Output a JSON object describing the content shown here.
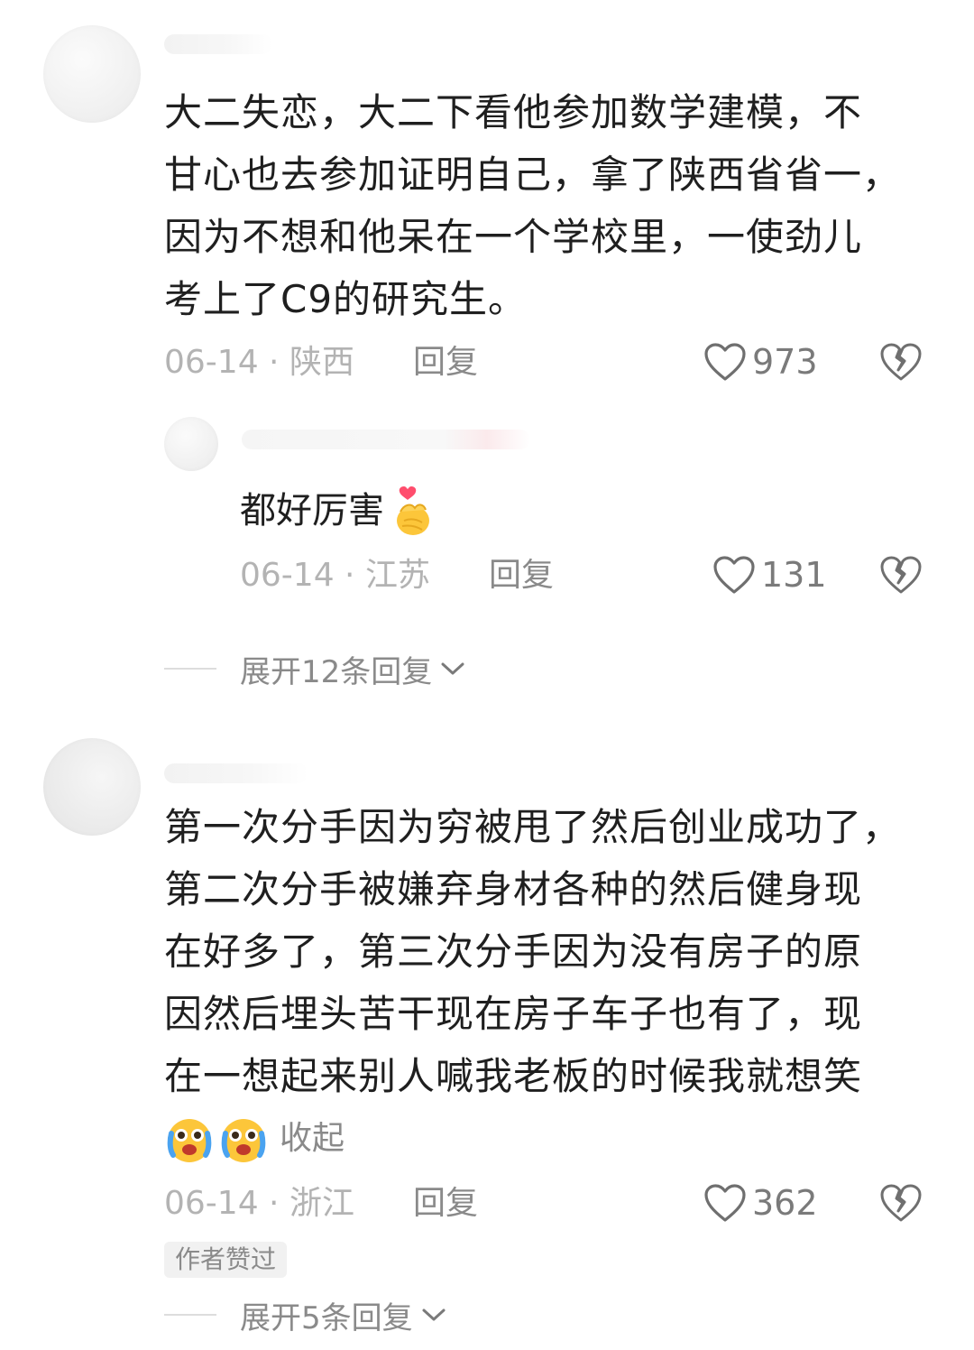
{
  "comments": [
    {
      "text": "大二失恋，大二下看他参加数学建模，不\n甘心也去参加证明自己，拿了陕西省省一，\n因为不想和他呆在一个学校里，一使劲儿\n考上了C9的研究生。",
      "date": "06-14",
      "location": "陕西",
      "reply_label": "回复",
      "likes": "973",
      "replies": [
        {
          "text": "都好厉害",
          "date": "06-14",
          "location": "江苏",
          "reply_label": "回复",
          "likes": "131"
        }
      ],
      "expand_label": "展开12条回复"
    },
    {
      "text": "第一次分手因为穷被甩了然后创业成功了，\n第二次分手被嫌弃身材各种的然后健身现\n在好多了，第三次分手因为没有房子的原\n因然后埋头苦干现在房子车子也有了，现\n在一想起来别人喊我老板的时候我就想笑",
      "collapse_label": "收起",
      "date": "06-14",
      "location": "浙江",
      "reply_label": "回复",
      "likes": "362",
      "author_badge": "作者赞过",
      "expand_label": "展开5条回复"
    }
  ],
  "separator": " · ",
  "icons": {
    "like": "heart-outline-icon",
    "dislike": "broken-heart-icon",
    "chevron": "chevron-down-icon",
    "finger_heart": "finger-heart-emoji",
    "crying_laughing": "crying-face-emoji"
  }
}
